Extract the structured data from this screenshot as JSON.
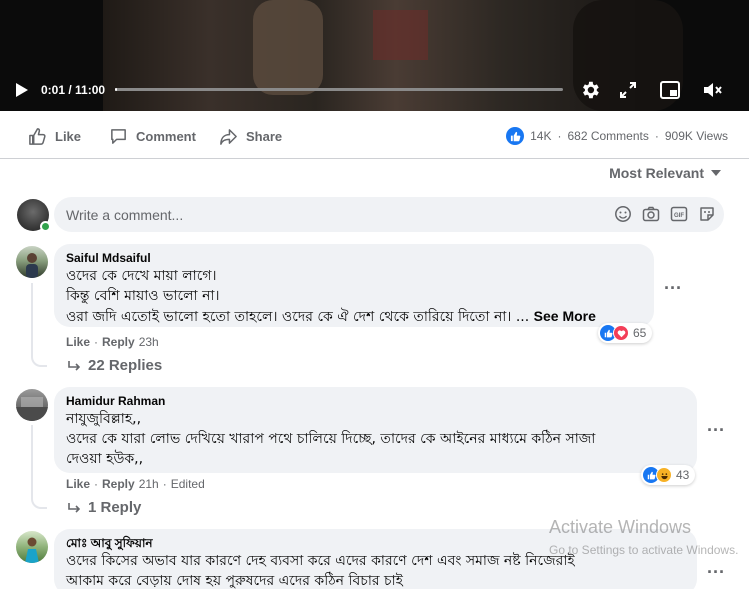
{
  "video": {
    "time": "0:01 / 11:00",
    "progress_fraction": 0.0
  },
  "actions": {
    "like_label": "Like",
    "comment_label": "Comment",
    "share_label": "Share"
  },
  "stats": {
    "likes": "14K",
    "separator1": "·",
    "comments": "682 Comments",
    "separator2": "·",
    "views": "909K Views"
  },
  "sort": {
    "label": "Most Relevant"
  },
  "composer": {
    "placeholder": "Write a comment..."
  },
  "comments": [
    {
      "author": "Saiful Mdsaiful",
      "lines": [
        "ওদের কে দেখে মায়া লাগে।",
        "কিন্তু বেশি মায়াও ভালো না।",
        "ওরা জদি এতোই ভালো হতো তাহলে। ওদের কে ঐ দেশ থেকে তারিয়ে দিতো না।"
      ],
      "ellipsis": "...",
      "see_more": "See More",
      "reaction_count": "65",
      "like": "Like",
      "dot": "·",
      "reply": "Reply",
      "time": "23h",
      "replies": "22 Replies"
    },
    {
      "author": "Hamidur Rahman",
      "lines": [
        "নাযুজুবিল্লাহ,,",
        "ওদের কে যারা লোভ দেখিয়ে খারাপ পথে চালিয়ে দিচ্ছে, তাদের কে আইনের মাধ্যমে কঠিন সাজা",
        "দেওয়া হউক,,"
      ],
      "reaction_count": "43",
      "like": "Like",
      "dot": "·",
      "reply": "Reply",
      "time": "21h",
      "edited": "Edited",
      "replies": "1 Reply"
    },
    {
      "author": "মোঃ আবু সুফিয়ান",
      "lines": [
        "ওদের কিসের অভাব যার কারণে দেহ ব্যবসা করে এদের কারণে দেশ এবং সমাজ নষ্ট নিজেরাই",
        "আকাম করে বেড়ায় দোষ হয় পুরুষদের এদের কঠিন বিচার চাই"
      ]
    }
  ],
  "watermark": {
    "title": "Activate Windows",
    "subtitle": "Go to Settings to activate Windows."
  },
  "colors": {
    "accent": "#1877f2",
    "bubble": "#f0f2f5",
    "secondary_text": "#65676b"
  }
}
